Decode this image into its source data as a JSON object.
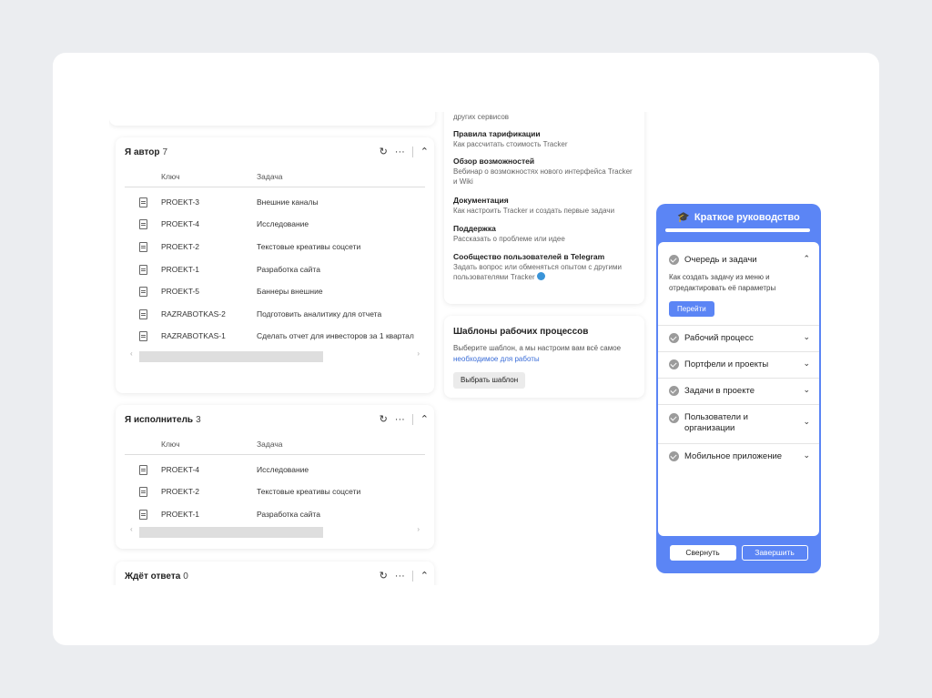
{
  "widgets": [
    {
      "title": "Я автор",
      "count": "7",
      "columns": {
        "key": "Ключ",
        "task": "Задача"
      },
      "rows": [
        {
          "key": "PROEKT-3",
          "task": "Внешние каналы"
        },
        {
          "key": "PROEKT-4",
          "task": "Исследование"
        },
        {
          "key": "PROEKT-2",
          "task": "Текстовые креативы соцсети"
        },
        {
          "key": "PROEKT-1",
          "task": "Разработка сайта"
        },
        {
          "key": "PROEKT-5",
          "task": "Баннеры внешние"
        },
        {
          "key": "RAZRABOTKAS-2",
          "task": "Подготовить аналитику для отчета"
        },
        {
          "key": "RAZRABOTKAS-1",
          "task": "Сделать отчет для инвесторов за 1 квартал"
        }
      ]
    },
    {
      "title": "Я исполнитель",
      "count": "3",
      "columns": {
        "key": "Ключ",
        "task": "Задача"
      },
      "rows": [
        {
          "key": "PROEKT-4",
          "task": "Исследование"
        },
        {
          "key": "PROEKT-2",
          "task": "Текстовые креативы соцсети"
        },
        {
          "key": "PROEKT-1",
          "task": "Разработка сайта"
        }
      ]
    },
    {
      "title": "Ждёт ответа",
      "count": "0"
    }
  ],
  "icons": {
    "refresh": "refresh-icon",
    "more": "more-icon",
    "collapse": "chevron-up-icon",
    "doc": "document-icon"
  },
  "help": {
    "top_fragment": "других сервисов",
    "items": [
      {
        "title": "Правила тарификации",
        "desc": "Как рассчитать стоимость Tracker"
      },
      {
        "title": "Обзор возможностей",
        "desc": "Вебинар о возможностях нового интерфейса Tracker и Wiki"
      },
      {
        "title": "Документация",
        "desc": "Как настроить Tracker и создать первые задачи"
      },
      {
        "title": "Поддержка",
        "desc": "Рассказать о проблеме или идее"
      },
      {
        "title": "Сообщество пользователей в Telegram",
        "desc": "Задать вопрос или обменяться опытом с другими пользователями Tracker"
      }
    ]
  },
  "templates": {
    "title": "Шаблоны рабочих процессов",
    "desc": "Выберите шаблон, а мы настроим вам всё самое",
    "link": "необходимое для работы",
    "button": "Выбрать шаблон"
  },
  "guide": {
    "title": "Краткое руководство",
    "sections": [
      {
        "label": "Очередь и задачи",
        "expanded": true,
        "desc": "Как создать задачу из меню и отредактировать её параметры",
        "button": "Перейти"
      },
      {
        "label": "Рабочий процесс"
      },
      {
        "label": "Портфели и проекты"
      },
      {
        "label": "Задачи в проекте"
      },
      {
        "label": "Пользователи и организации"
      },
      {
        "label": "Мобильное приложение"
      }
    ],
    "collapse_button": "Свернуть",
    "finish_button": "Завершить"
  },
  "colors": {
    "accent": "#5b85f5",
    "link": "#3a6dd8",
    "background": "#ebedf0"
  }
}
